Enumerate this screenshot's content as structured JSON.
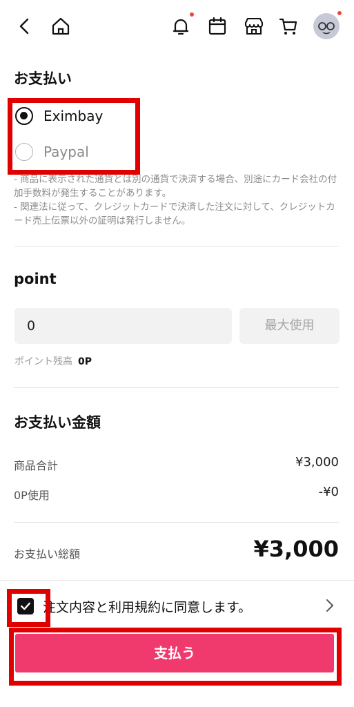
{
  "header": {
    "icons": [
      "back-icon",
      "home-icon",
      "bell-icon",
      "calendar-icon",
      "store-icon",
      "cart-icon",
      "avatar"
    ]
  },
  "payment": {
    "title": "お支払い",
    "options": [
      {
        "label": "Eximbay",
        "selected": true
      },
      {
        "label": "Paypal",
        "selected": false
      }
    ],
    "notes": [
      "- 商品に表示された通貨とは別の通貨で決済する場合、別途にカード会社の付加手数料が発生することがあります。",
      "- 関連法に従って、クレジットカードで決済した注文に対して、クレジットカード売上伝票以外の証明は発行しません。"
    ]
  },
  "point": {
    "title": "point",
    "input_value": "0",
    "max_button": "最大使用",
    "balance_label": "ポイント残高",
    "balance_value": "0P"
  },
  "summary": {
    "title": "お支払い金額",
    "subtotal_label": "商品合計",
    "subtotal_value": "¥3,000",
    "points_label": "0P使用",
    "points_value": "-¥0",
    "total_label": "お支払い総額",
    "total_value": "¥3,000"
  },
  "agreement": {
    "checked": true,
    "text": "注文内容と利用規約に同意します。"
  },
  "pay_button": "支払う",
  "colors": {
    "accent": "#f03a6e",
    "highlight": "#e00000",
    "notification_dot": "#f0453a"
  }
}
